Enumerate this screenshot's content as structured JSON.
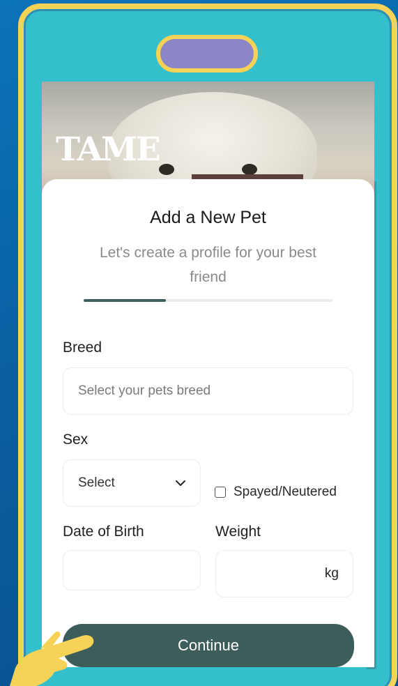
{
  "brand": {
    "logo_text": "TAME"
  },
  "header": {
    "title": "Add a New Pet",
    "subtitle": "Let's create a profile for your best friend"
  },
  "progress": {
    "fraction": 0.33
  },
  "form": {
    "breed": {
      "label": "Breed",
      "placeholder": "Select your pets breed"
    },
    "sex": {
      "label": "Sex",
      "selected": "Select"
    },
    "spayed": {
      "label": "Spayed/Neutered",
      "checked": false
    },
    "dob": {
      "label": "Date of Birth",
      "value": ""
    },
    "weight": {
      "label": "Weight",
      "value": "",
      "unit": "kg"
    }
  },
  "actions": {
    "continue_label": "Continue"
  },
  "icons": {
    "dropdown": "chevron-down-icon",
    "pointer": "pointing-hand-icon"
  },
  "colors": {
    "primary": "#3d5d5b",
    "badge_frame": "#f6d356",
    "badge_body": "#34bfcc",
    "badge_slot": "#8d86c6",
    "background": "#0b5c9e"
  }
}
